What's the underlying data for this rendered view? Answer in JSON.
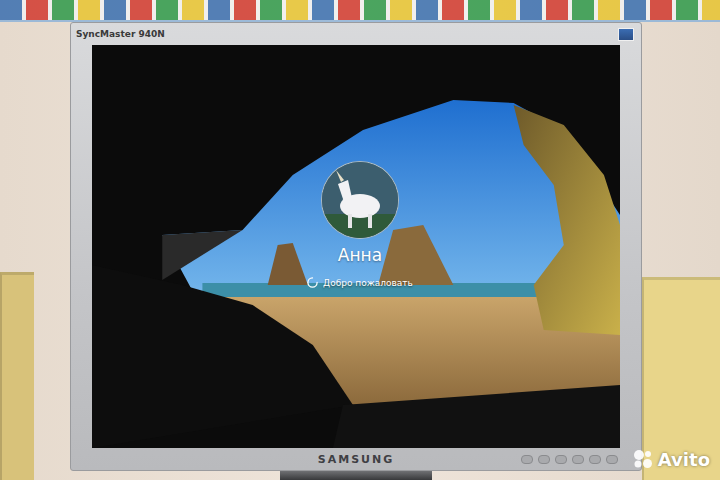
{
  "monitor": {
    "model": "SyncMaster 940N",
    "brand": "SAMSUNG"
  },
  "login": {
    "user": "Анна",
    "status": "Добро пожаловать",
    "busy": true
  },
  "watermark": {
    "text": "Avito"
  }
}
